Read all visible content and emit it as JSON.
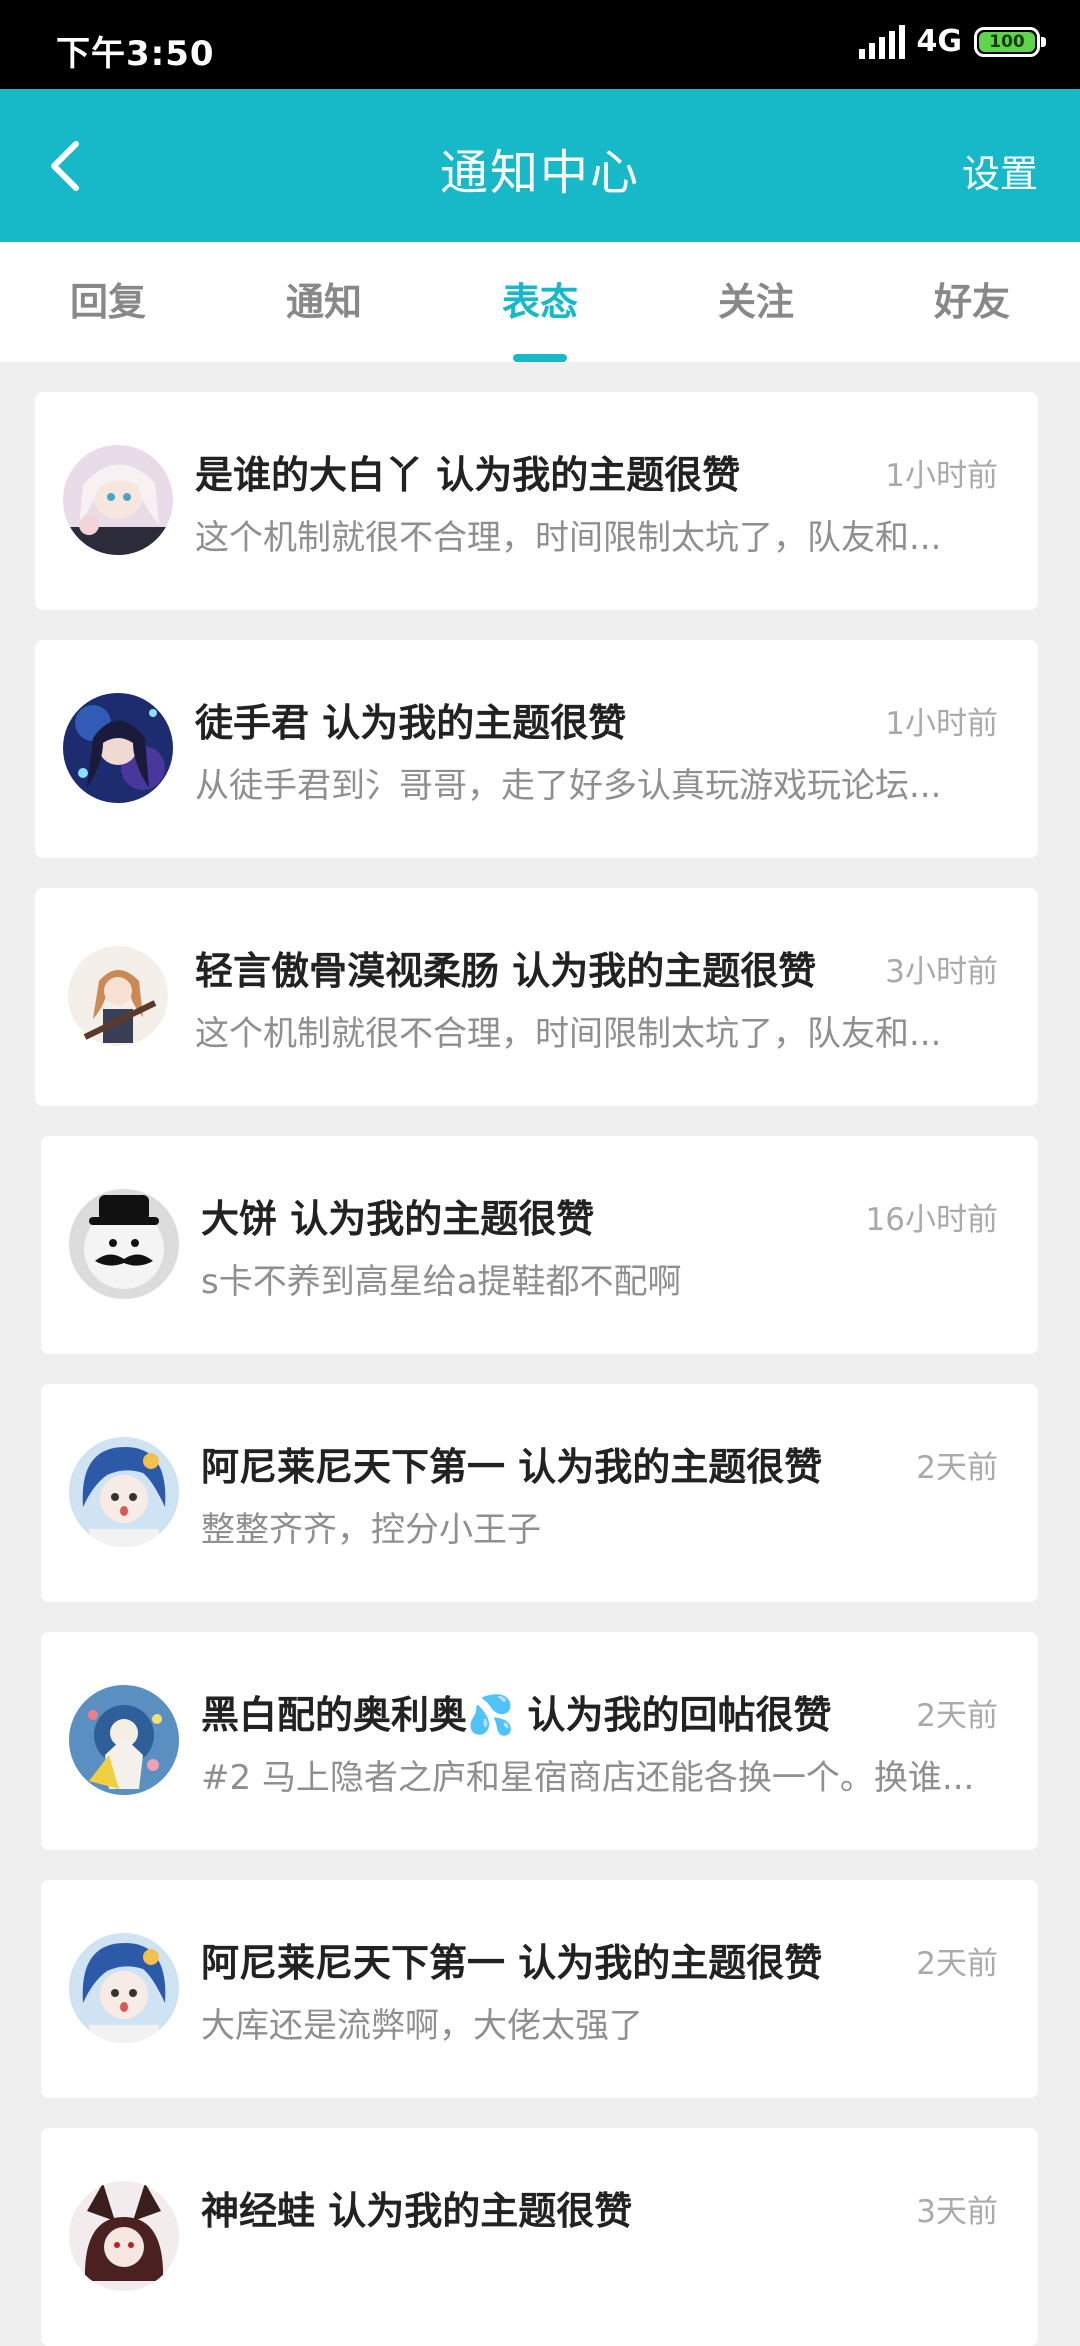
{
  "status_bar": {
    "time": "下午3:50",
    "network": "4G",
    "battery": "100"
  },
  "header": {
    "title": "通知中心",
    "settings_label": "设置"
  },
  "tabs": [
    {
      "label": "回复",
      "active": false
    },
    {
      "label": "通知",
      "active": false
    },
    {
      "label": "表态",
      "active": true
    },
    {
      "label": "关注",
      "active": false
    },
    {
      "label": "好友",
      "active": false
    }
  ],
  "notifications": [
    {
      "user": "是谁的大白丫",
      "action": "认为我的主题很赞",
      "title": "是谁的大白丫 认为我的主题很赞",
      "time": "1小时前",
      "excerpt": "这个机制就很不合理，时间限制太坑了，队友和..."
    },
    {
      "user": "徒手君",
      "action": "认为我的主题很赞",
      "title": "徒手君 认为我的主题很赞",
      "time": "1小时前",
      "excerpt": "从徒手君到氵哥哥，走了好多认真玩游戏玩论坛..."
    },
    {
      "user": "轻言傲骨漠视柔肠",
      "action": "认为我的主题很赞",
      "title": "轻言傲骨漠视柔肠 认为我的主题很赞",
      "time": "3小时前",
      "excerpt": "这个机制就很不合理，时间限制太坑了，队友和..."
    },
    {
      "user": "大饼",
      "action": "认为我的主题很赞",
      "title": "大饼 认为我的主题很赞",
      "time": "16小时前",
      "excerpt": "s卡不养到高星给a提鞋都不配啊"
    },
    {
      "user": "阿尼莱尼天下第一",
      "action": "认为我的主题很赞",
      "title": "阿尼莱尼天下第一 认为我的主题很赞",
      "time": "2天前",
      "excerpt": "整整齐齐，控分小王子"
    },
    {
      "user": "黑白配的奥利奥💦",
      "action": "认为我的回帖很赞",
      "title": "黑白配的奥利奥💦 认为我的回帖很赞",
      "time": "2天前",
      "excerpt": "#2 马上隐者之庐和星宿商店还能各换一个。换谁..."
    },
    {
      "user": "阿尼莱尼天下第一",
      "action": "认为我的主题很赞",
      "title": "阿尼莱尼天下第一 认为我的主题很赞",
      "time": "2天前",
      "excerpt": "大库还是流弊啊，大佬太强了"
    },
    {
      "user": "神经蛙",
      "action": "认为我的主题很赞",
      "title": "神经蛙 认为我的主题很赞",
      "time": "3天前",
      "excerpt": ""
    }
  ],
  "colors": {
    "accent": "#17b8c8",
    "background": "#efefef",
    "title_text": "#222222",
    "muted_text": "#8f8f8f"
  }
}
